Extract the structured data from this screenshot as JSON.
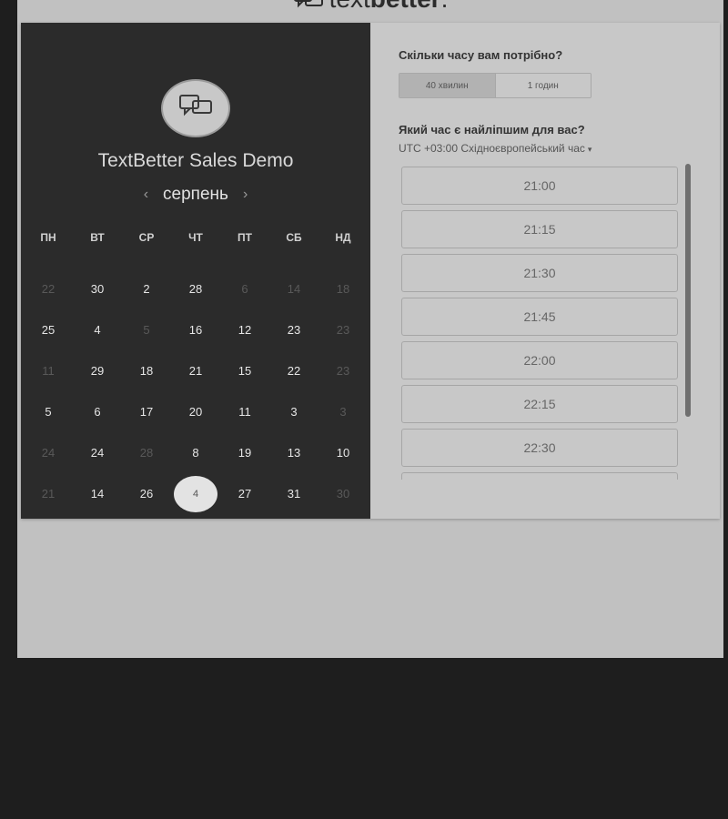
{
  "brand": {
    "light": "text",
    "bold": "better",
    "dot": "."
  },
  "calendar": {
    "title": "TextBetter Sales Demo",
    "month": "серпень",
    "prev_arrow": "‹",
    "next_arrow": "›",
    "weekdays": [
      "ПН",
      "ВТ",
      "СР",
      "ЧТ",
      "ПТ",
      "СБ",
      "НД"
    ],
    "rows": [
      [
        "22",
        "30",
        "2",
        "28",
        "6",
        "14",
        "18"
      ],
      [
        "25",
        "4",
        "5",
        "16",
        "12",
        "23",
        "23"
      ],
      [
        "11",
        "29",
        "18",
        "21",
        "15",
        "22",
        "23"
      ],
      [
        "5",
        "6",
        "17",
        "20",
        "11",
        "3",
        "3"
      ],
      [
        "24",
        "24",
        "28",
        "8",
        "19",
        "13",
        "10"
      ],
      [
        "21",
        "14",
        "26",
        "4",
        "27",
        "31",
        "30"
      ]
    ],
    "muted": [
      [
        true,
        false,
        false,
        false,
        true,
        true,
        true
      ],
      [
        false,
        false,
        true,
        false,
        false,
        false,
        true
      ],
      [
        true,
        false,
        false,
        false,
        false,
        false,
        true
      ],
      [
        false,
        false,
        false,
        false,
        false,
        false,
        true
      ],
      [
        true,
        false,
        true,
        false,
        false,
        false,
        false
      ],
      [
        true,
        false,
        false,
        false,
        false,
        false,
        true
      ]
    ],
    "selected": {
      "row": 5,
      "col": 3
    }
  },
  "booking": {
    "duration_question": "Скільки часу вам потрібно?",
    "durations": [
      "40 хвилин",
      "1 годин"
    ],
    "selected_duration": "40 хвилин",
    "time_question": "Який час є найліпшим для вас?",
    "timezone": "UTC +03:00 Східноєвропейський час",
    "timezone_caret": "▾",
    "slots": [
      "21:00",
      "21:15",
      "21:30",
      "21:45",
      "22:00",
      "22:15",
      "22:30",
      ""
    ]
  }
}
